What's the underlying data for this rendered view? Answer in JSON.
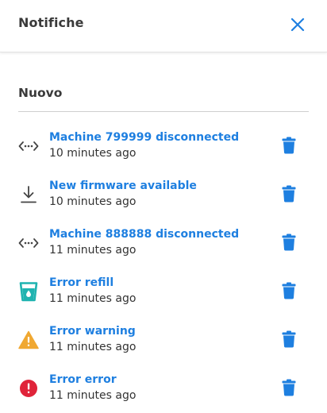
{
  "header": {
    "title": "Notifiche",
    "close_icon": "close-icon"
  },
  "section": {
    "title": "Nuovo"
  },
  "colors": {
    "accent": "#1e7fe0",
    "warning": "#f0a832",
    "error": "#e0243a",
    "refill": "#1fb3b0"
  },
  "notifications": [
    {
      "title": "Machine 799999 disconnected",
      "time": "10 minutes ago",
      "icon": "disconnected-icon"
    },
    {
      "title": "New firmware available",
      "time": "10 minutes ago",
      "icon": "download-icon"
    },
    {
      "title": "Machine 888888 disconnected",
      "time": "11 minutes ago",
      "icon": "disconnected-icon"
    },
    {
      "title": "Error refill",
      "time": "11 minutes ago",
      "icon": "refill-icon"
    },
    {
      "title": "Error warning",
      "time": "11 minutes ago",
      "icon": "warning-icon"
    },
    {
      "title": "Error error",
      "time": "11 minutes ago",
      "icon": "error-icon"
    }
  ]
}
